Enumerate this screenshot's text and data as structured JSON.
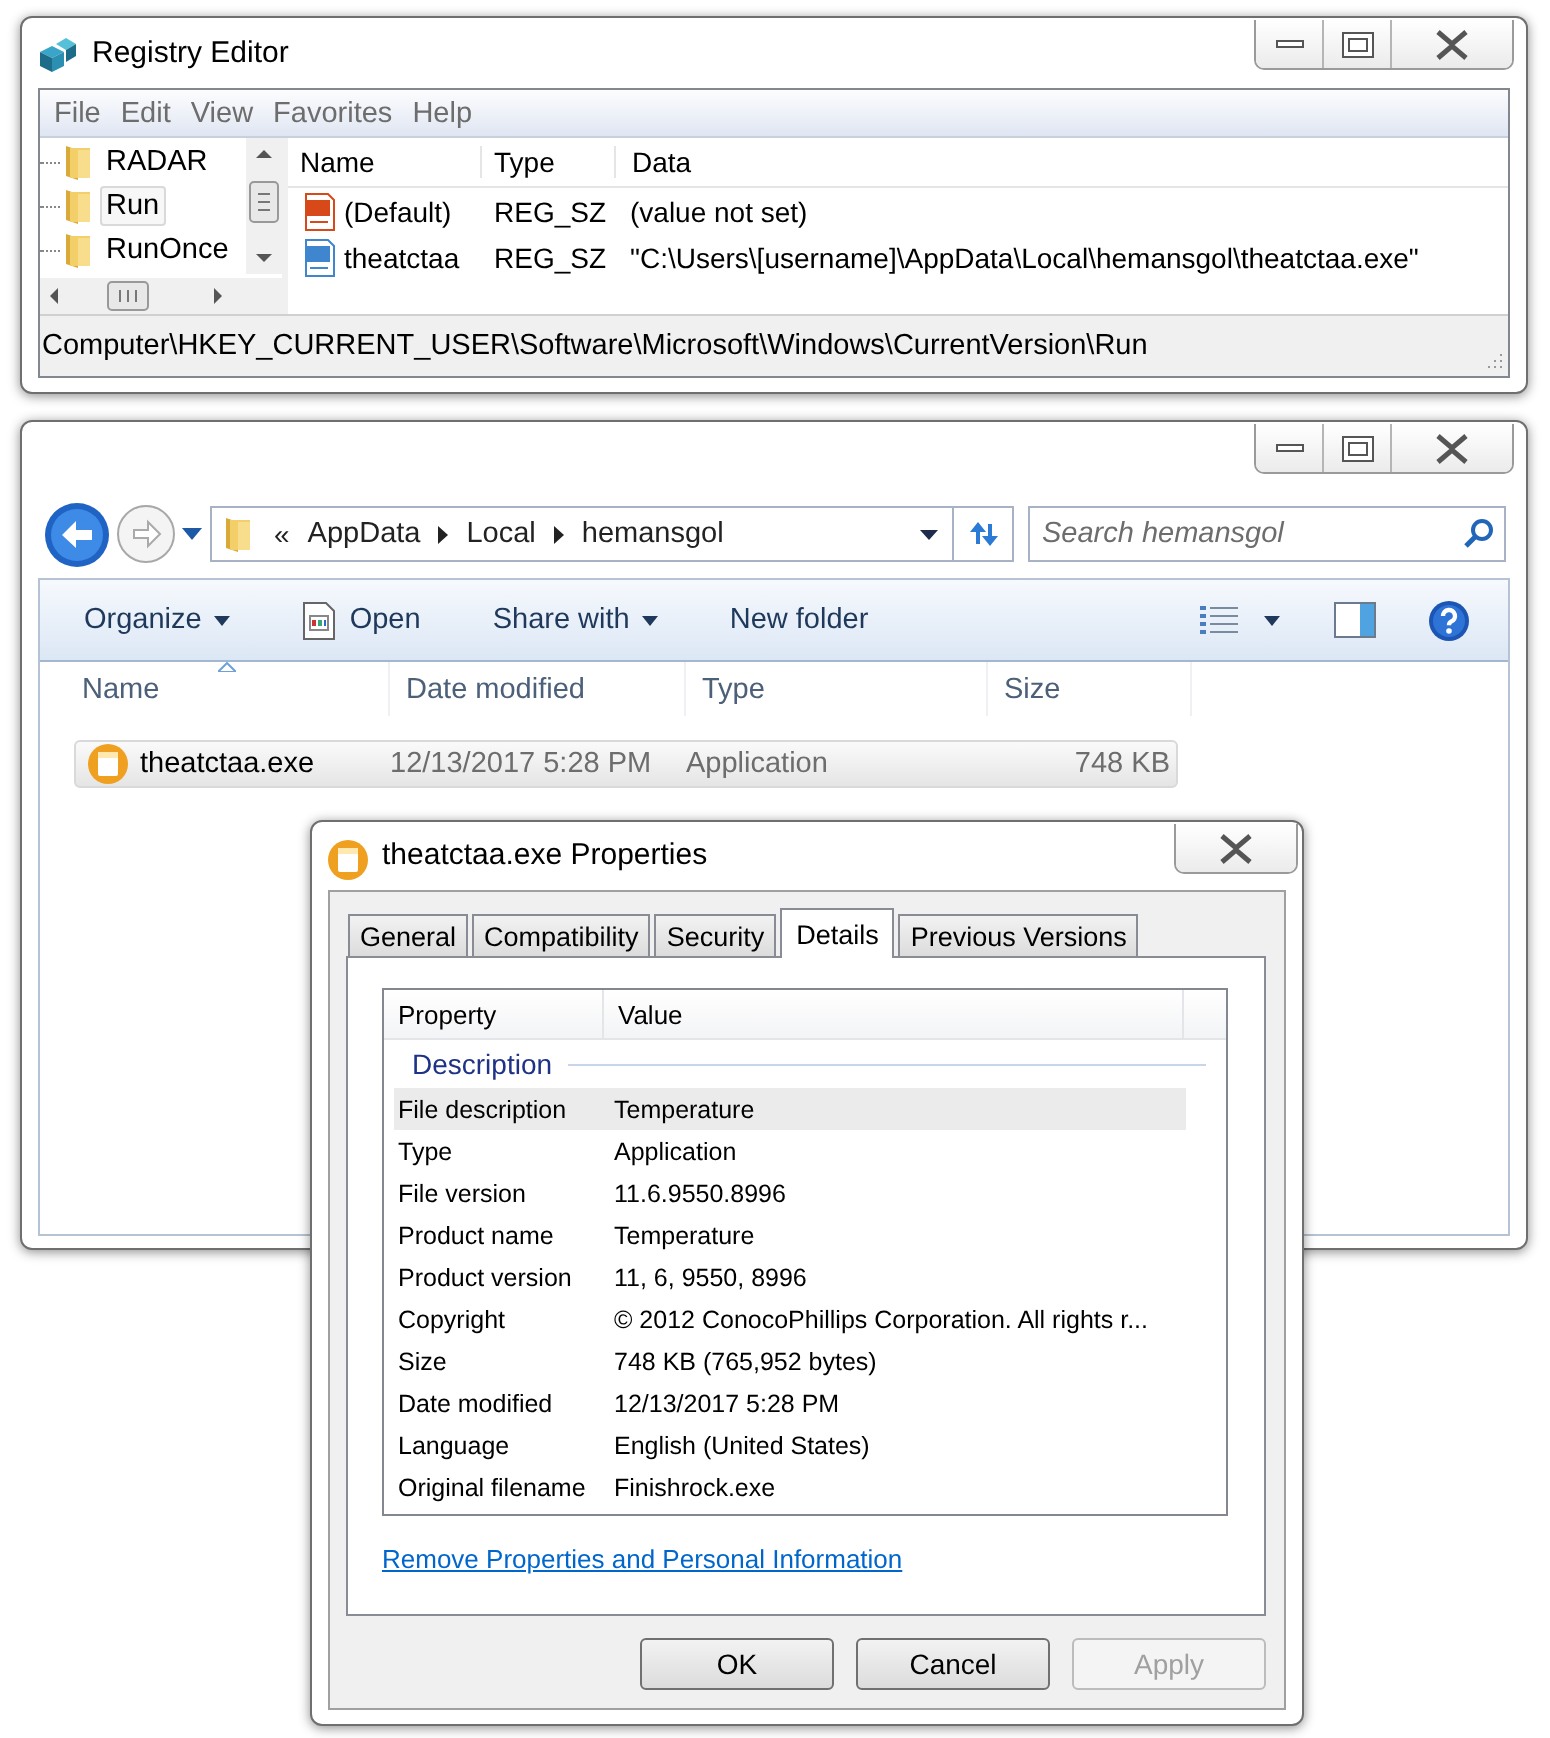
{
  "registry_editor": {
    "title": "Registry Editor",
    "menu": [
      "File",
      "Edit",
      "View",
      "Favorites",
      "Help"
    ],
    "tree": [
      {
        "label": "RADAR",
        "selected": false
      },
      {
        "label": "Run",
        "selected": true
      },
      {
        "label": "RunOnce",
        "selected": false
      }
    ],
    "columns": [
      "Name",
      "Type",
      "Data"
    ],
    "values": [
      {
        "kind": "default",
        "name": "(Default)",
        "type": "REG_SZ",
        "data": "(value not set)"
      },
      {
        "kind": "string",
        "name": "theatctaa",
        "type": "REG_SZ",
        "data": "\"C:\\Users\\[username]\\AppData\\Local\\hemansgol\\theatctaa.exe\""
      }
    ],
    "status_bar": "Computer\\HKEY_CURRENT_USER\\Software\\Microsoft\\Windows\\CurrentVersion\\Run"
  },
  "explorer": {
    "address": {
      "overflow": "«",
      "crumbs": [
        "AppData",
        "Local",
        "hemansgol"
      ]
    },
    "search": {
      "placeholder": "Search hemansgol"
    },
    "toolbar": [
      {
        "label": "Organize",
        "kind": "plain",
        "dropdown": true
      },
      {
        "label": "Open",
        "kind": "open",
        "dropdown": false
      },
      {
        "label": "Share with",
        "kind": "plain",
        "dropdown": true
      },
      {
        "label": "New folder",
        "kind": "plain",
        "dropdown": false
      }
    ],
    "columns": [
      {
        "label": "Name",
        "sorted": true
      },
      {
        "label": "Date modified",
        "sorted": false
      },
      {
        "label": "Type",
        "sorted": false
      },
      {
        "label": "Size",
        "sorted": false
      }
    ],
    "files": [
      {
        "name": "theatctaa.exe",
        "date_modified": "12/13/2017 5:28 PM",
        "type": "Application",
        "size": "748 KB",
        "selected": true
      }
    ]
  },
  "properties": {
    "title": "theatctaa.exe Properties",
    "tabs": [
      {
        "label": "General",
        "selected": false
      },
      {
        "label": "Compatibility",
        "selected": false
      },
      {
        "label": "Security",
        "selected": false
      },
      {
        "label": "Details",
        "selected": true
      },
      {
        "label": "Previous Versions",
        "selected": false
      }
    ],
    "columns": [
      "Property",
      "Value"
    ],
    "group": "Description",
    "rows": [
      {
        "property": "File description",
        "value": "Temperature",
        "selected": true
      },
      {
        "property": "Type",
        "value": "Application",
        "selected": false
      },
      {
        "property": "File version",
        "value": "11.6.9550.8996",
        "selected": false
      },
      {
        "property": "Product name",
        "value": "Temperature",
        "selected": false
      },
      {
        "property": "Product version",
        "value": "11, 6, 9550, 8996",
        "selected": false
      },
      {
        "property": "Copyright",
        "value": "© 2012 ConocoPhillips Corporation. All rights r...",
        "selected": false
      },
      {
        "property": "Size",
        "value": "748 KB (765,952 bytes)",
        "selected": false
      },
      {
        "property": "Date modified",
        "value": "12/13/2017 5:28 PM",
        "selected": false
      },
      {
        "property": "Language",
        "value": "English (United States)",
        "selected": false
      },
      {
        "property": "Original filename",
        "value": "Finishrock.exe",
        "selected": false
      }
    ],
    "link": "Remove Properties and Personal Information",
    "buttons": [
      {
        "label": "OK",
        "disabled": false
      },
      {
        "label": "Cancel",
        "disabled": false
      },
      {
        "label": "Apply",
        "disabled": true
      }
    ]
  }
}
